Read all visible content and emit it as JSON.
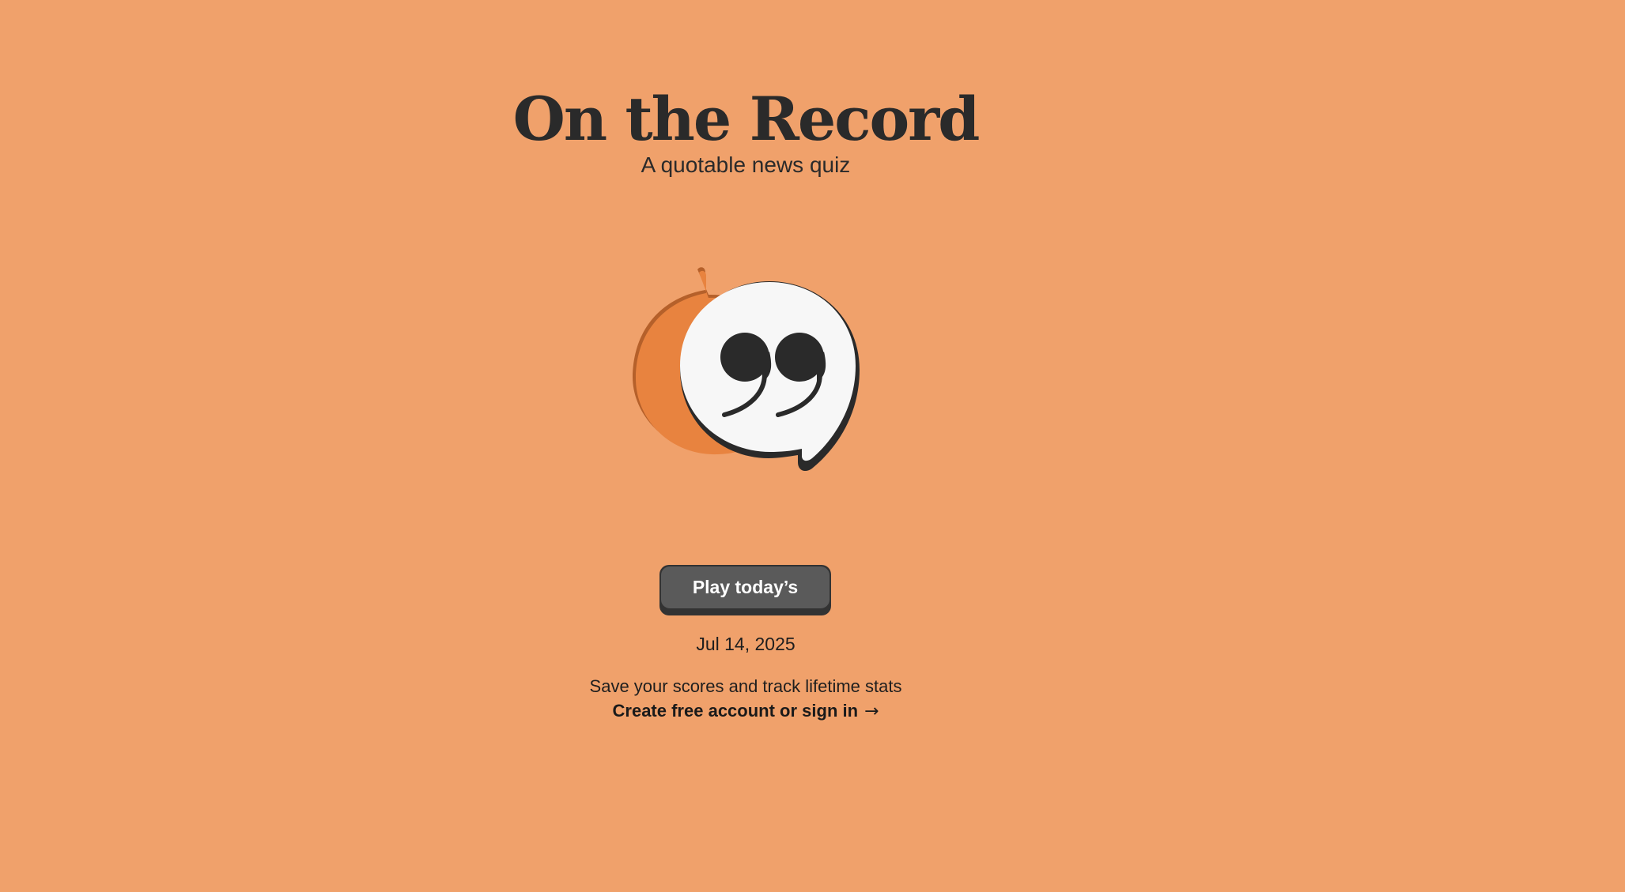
{
  "header": {
    "title": "On the Record",
    "subtitle": "A quotable news quiz"
  },
  "logo": {
    "icon": "quote-speech-bubble-icon",
    "colors": {
      "front_bubble": "#F7F7F7",
      "back_bubble": "#E8833F",
      "outline": "#2A2A2A",
      "back_shadow": "#B5602A"
    }
  },
  "actions": {
    "play_label": "Play today’s",
    "date": "Jul 14, 2025"
  },
  "account": {
    "prompt": "Save your scores and track lifetime stats",
    "link_label": "Create free account or sign in",
    "link_icon": "arrow-right-icon",
    "link_arrow": "→"
  },
  "colors": {
    "background": "#F0A16B",
    "button": "#5A5A5A",
    "button_shadow": "#333333",
    "text": "#2A2A2A"
  }
}
